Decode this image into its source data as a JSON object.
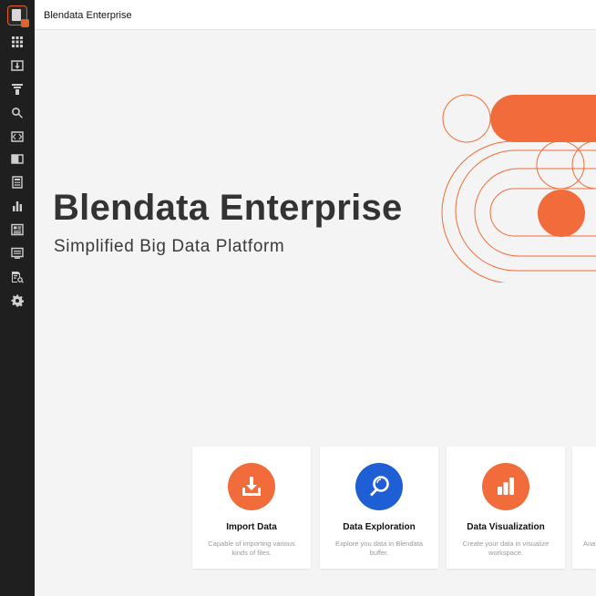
{
  "app": {
    "title": "Blendata Enterprise"
  },
  "sidebar": {
    "items": [
      {
        "icon": "apps-grid-icon"
      },
      {
        "icon": "import-tray-icon"
      },
      {
        "icon": "filter-funnel-icon"
      },
      {
        "icon": "search-icon"
      },
      {
        "icon": "code-icon"
      },
      {
        "icon": "book-icon"
      },
      {
        "icon": "calculator-icon"
      },
      {
        "icon": "bar-chart-icon"
      },
      {
        "icon": "dashboard-icon"
      },
      {
        "icon": "monitor-list-icon"
      },
      {
        "icon": "document-search-icon"
      },
      {
        "icon": "gear-icon"
      }
    ]
  },
  "hero": {
    "title": "Blendata Enterprise",
    "subtitle": "Simplified Big Data Platform"
  },
  "colors": {
    "accent": "#f26b3a",
    "blue": "#1f5fd6",
    "sidebar": "#1f1f1f"
  },
  "cards": [
    {
      "icon": "download-icon",
      "title": "Import Data",
      "description": "Capable of importing various kinds of files."
    },
    {
      "icon": "magnifier-icon",
      "title": "Data Exploration",
      "description": "Explore you data in Blendata buffer."
    },
    {
      "icon": "bar-chart-icon",
      "title": "Data Visualization",
      "description": "Create your data in visualize workspace."
    },
    {
      "description": "Ana"
    }
  ]
}
